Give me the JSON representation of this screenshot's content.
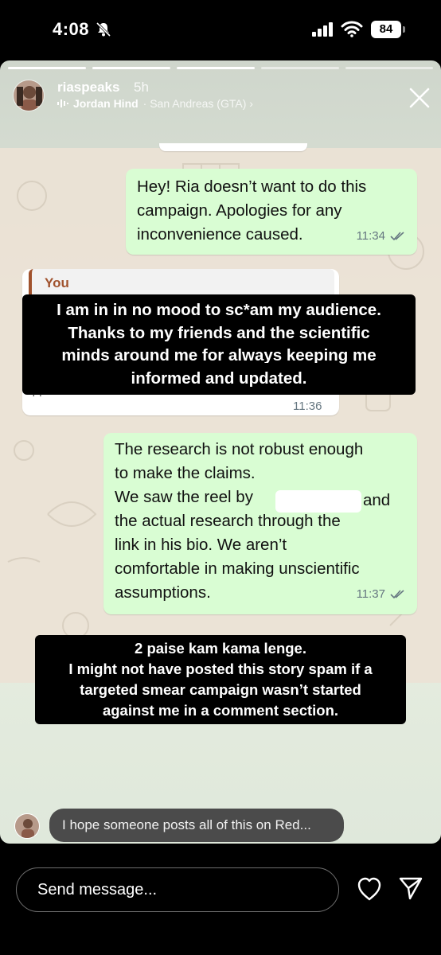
{
  "status_bar": {
    "time": "4:08",
    "battery": "84",
    "icons": [
      "bell-slash-icon",
      "cellular-signal-icon",
      "wifi-icon",
      "battery-icon"
    ]
  },
  "story": {
    "username": "riaspeaks",
    "time_ago": "5h",
    "music_artist": "Jordan Hind",
    "music_location": "· San Andreas (GTA) ›",
    "progress_segments": 5,
    "close_icon": "close-icon"
  },
  "chat": {
    "messages": [
      {
        "direction": "outgoing",
        "text": "Hey! Ria doesn’t want to do this\ncampaign. Apologies for any\ninconvenience caused.",
        "time": "11:34",
        "status": "read"
      },
      {
        "direction": "incoming",
        "quote_name": "You",
        "text": "",
        "time": "11:36"
      },
      {
        "direction": "outgoing",
        "text": "The research is not robust enough\nto make the claims.\nWe saw the reel by\nthe actual research through the\nlink in his bio. We aren’t\ncomfortable in making unscientific\nassumptions.",
        "text_after_redaction": "and",
        "time": "11:37",
        "status": "read"
      }
    ]
  },
  "overlays": {
    "caption_1": [
      "I am in in no mood to sc*am my audience.",
      "Thanks to my friends and the scientific",
      "minds around me for always keeping me",
      "informed and updated."
    ],
    "caption_2": [
      "2 paise kam kama lenge.",
      "I might not have posted this story spam if a",
      "targeted smear campaign wasn’t started",
      "against me in a comment section."
    ]
  },
  "reply": {
    "text": "I hope someone posts all of this on Red..."
  },
  "composer": {
    "placeholder": "Send message...",
    "icons": [
      "heart-icon",
      "send-icon"
    ]
  },
  "colors": {
    "outgoing_bubble": "#d9fdd3",
    "incoming_bubble": "#ffffff",
    "caption_bg": "#000000",
    "quote_accent": "#a0522d"
  }
}
